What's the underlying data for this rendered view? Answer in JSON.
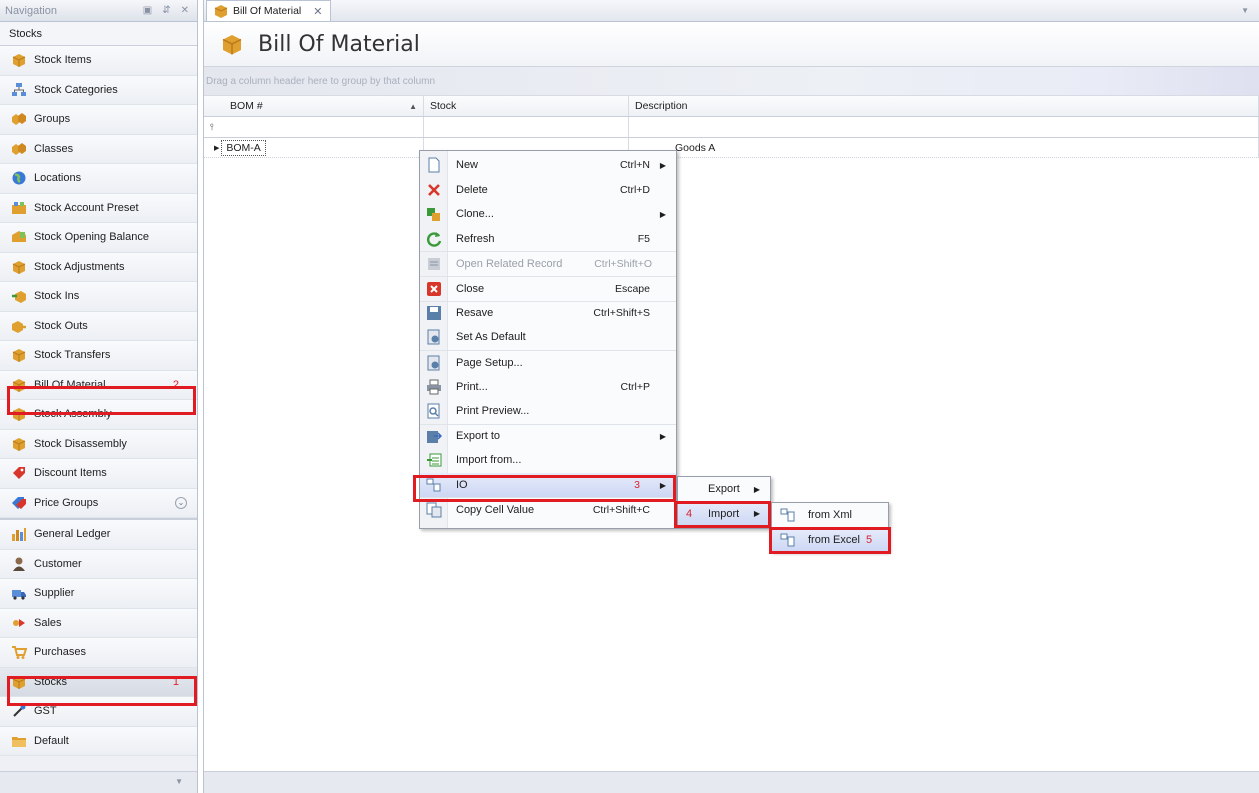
{
  "navigation": {
    "header_title": "Navigation",
    "group_title": "Stocks",
    "items": [
      {
        "label": "Stock Items",
        "icon": "box-icon"
      },
      {
        "label": "Stock Categories",
        "icon": "categories-icon"
      },
      {
        "label": "Groups",
        "icon": "groups-icon"
      },
      {
        "label": "Classes",
        "icon": "classes-icon"
      },
      {
        "label": "Locations",
        "icon": "globe-icon"
      },
      {
        "label": "Stock Account Preset",
        "icon": "preset-icon"
      },
      {
        "label": "Stock Opening Balance",
        "icon": "balance-icon"
      },
      {
        "label": "Stock Adjustments",
        "icon": "box-icon"
      },
      {
        "label": "Stock Ins",
        "icon": "stock-in-icon"
      },
      {
        "label": "Stock Outs",
        "icon": "stock-out-icon"
      },
      {
        "label": "Stock Transfers",
        "icon": "box-icon"
      },
      {
        "label": "Bill Of Material",
        "icon": "box-icon",
        "marker": "2"
      },
      {
        "label": "Stock Assembly",
        "icon": "box-icon"
      },
      {
        "label": "Stock Disassembly",
        "icon": "box-icon"
      },
      {
        "label": "Discount Items",
        "icon": "discount-icon"
      },
      {
        "label": "Price Groups",
        "icon": "price-icon"
      }
    ],
    "modules": [
      {
        "label": "General Ledger",
        "icon": "ledger-icon"
      },
      {
        "label": "Customer",
        "icon": "customer-icon"
      },
      {
        "label": "Supplier",
        "icon": "supplier-icon"
      },
      {
        "label": "Sales",
        "icon": "sales-icon"
      },
      {
        "label": "Purchases",
        "icon": "purchases-icon"
      },
      {
        "label": "Stocks",
        "icon": "box-icon",
        "marker": "1"
      },
      {
        "label": "GST",
        "icon": "gst-icon"
      },
      {
        "label": "Default",
        "icon": "folder-icon"
      }
    ]
  },
  "document": {
    "tab_label": "Bill Of Material",
    "title": "Bill Of Material",
    "group_hint": "Drag a column header here to group by that column",
    "columns": [
      "BOM #",
      "Stock",
      "Description"
    ],
    "rows": [
      {
        "bom": "BOM-A",
        "stock": "",
        "description": "Goods A"
      }
    ]
  },
  "context_menu": {
    "items": [
      {
        "label": "New",
        "shortcut": "Ctrl+N",
        "submenu": true,
        "icon": "new-icon"
      },
      {
        "label": "Delete",
        "shortcut": "Ctrl+D",
        "icon": "delete-icon"
      },
      {
        "label": "Clone...",
        "shortcut": "",
        "submenu": true,
        "icon": "clone-icon"
      },
      {
        "label": "Refresh",
        "shortcut": "F5",
        "icon": "refresh-icon"
      },
      {
        "label": "Open Related Record",
        "shortcut": "Ctrl+Shift+O",
        "disabled": true,
        "icon": "related-record-icon"
      },
      {
        "label": "Close",
        "shortcut": "Escape",
        "icon": "close-icon"
      },
      {
        "label": "Resave",
        "shortcut": "Ctrl+Shift+S",
        "icon": "resave-icon"
      },
      {
        "label": "Set As Default",
        "shortcut": "",
        "icon": "set-default-icon"
      },
      {
        "label": "Page Setup...",
        "shortcut": "",
        "icon": "page-setup-icon"
      },
      {
        "label": "Print...",
        "shortcut": "Ctrl+P",
        "icon": "print-icon"
      },
      {
        "label": "Print Preview...",
        "shortcut": "",
        "icon": "print-preview-icon"
      },
      {
        "label": "Export to",
        "shortcut": "",
        "submenu": true,
        "icon": "export-icon"
      },
      {
        "label": "Import from...",
        "shortcut": "",
        "icon": "import-icon"
      },
      {
        "label": "IO",
        "shortcut": "",
        "submenu": true,
        "marker": "3",
        "icon": "io-icon"
      },
      {
        "label": "Copy Cell Value",
        "shortcut": "Ctrl+Shift+C",
        "icon": "copy-icon"
      }
    ],
    "io_submenu": [
      {
        "label": "Export"
      },
      {
        "label": "Import",
        "marker": "4"
      }
    ],
    "import_submenu": [
      {
        "label": "from Xml"
      },
      {
        "label": "from Excel",
        "marker": "5"
      }
    ]
  },
  "colors": {
    "highlight": "#e11b22",
    "marker_text": "#d9232d"
  }
}
